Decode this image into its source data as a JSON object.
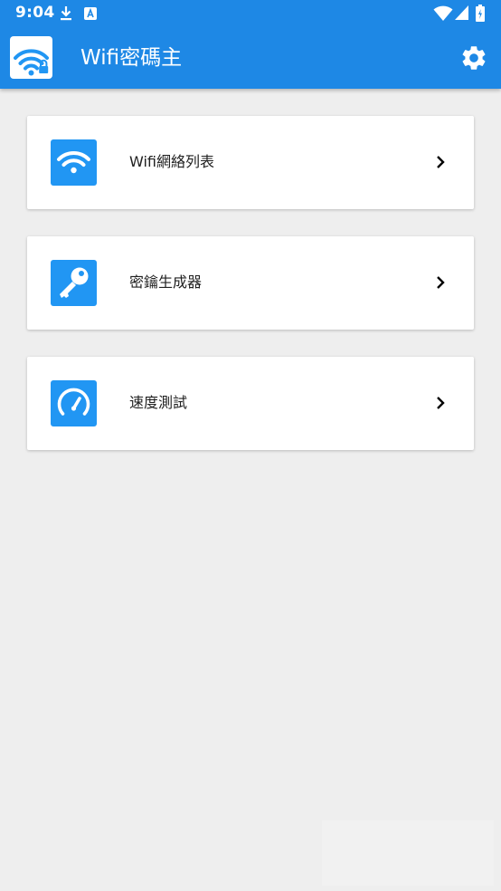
{
  "status_bar": {
    "time": "9:04"
  },
  "app_bar": {
    "title": "Wifi密碼主"
  },
  "menu": {
    "items": [
      {
        "label": "Wifi網絡列表",
        "icon": "wifi-icon"
      },
      {
        "label": "密鑰生成器",
        "icon": "key-icon"
      },
      {
        "label": "速度測試",
        "icon": "speedometer-icon"
      }
    ]
  },
  "colors": {
    "primary": "#1e88e5",
    "icon_tile": "#2196f3",
    "background": "#eeeeee",
    "card": "#ffffff",
    "text": "#212121"
  }
}
